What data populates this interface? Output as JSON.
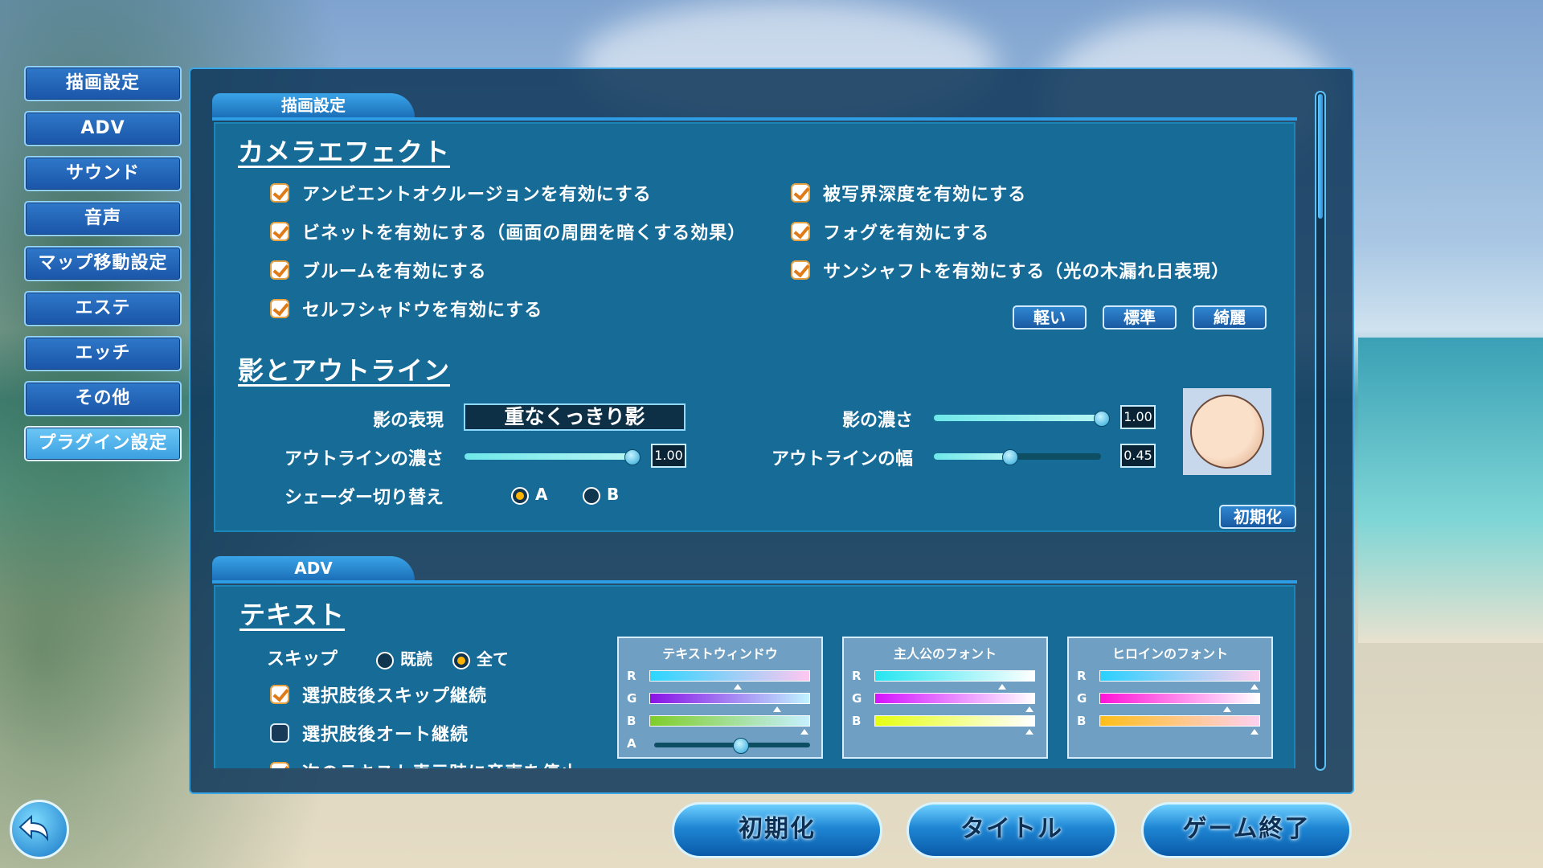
{
  "sidebar": {
    "items": [
      {
        "label": "描画設定"
      },
      {
        "label": "ADV"
      },
      {
        "label": "サウンド"
      },
      {
        "label": "音声"
      },
      {
        "label": "マップ移動設定"
      },
      {
        "label": "エステ"
      },
      {
        "label": "エッチ"
      },
      {
        "label": "その他"
      },
      {
        "label": "プラグイン設定"
      }
    ],
    "active_index": 8
  },
  "render_section": {
    "tab": "描画設定",
    "camera": {
      "heading": "カメラエフェクト",
      "options": [
        {
          "label": "アンビエントオクルージョンを有効にする",
          "checked": true
        },
        {
          "label": "ビネットを有効にする（画面の周囲を暗くする効果）",
          "checked": true
        },
        {
          "label": "ブルームを有効にする",
          "checked": true
        },
        {
          "label": "セルフシャドウを有効にする",
          "checked": true
        },
        {
          "label": "被写界深度を有効にする",
          "checked": true
        },
        {
          "label": "フォグを有効にする",
          "checked": true
        },
        {
          "label": "サンシャフトを有効にする（光の木漏れ日表現）",
          "checked": true
        }
      ],
      "presets": [
        "軽い",
        "標準",
        "綺麗"
      ]
    },
    "shadow": {
      "heading": "影とアウトライン",
      "shadow_style_label": "影の表現",
      "shadow_style_value": "重なくっきり影",
      "outline_density_label": "アウトラインの濃さ",
      "outline_density_value": "1.00",
      "outline_density": 1.0,
      "shader_label": "シェーダー切り替え",
      "shader_options": [
        "A",
        "B"
      ],
      "shader_selected": "A",
      "shadow_density_label": "影の濃さ",
      "shadow_density_value": "1.00",
      "shadow_density": 1.0,
      "outline_width_label": "アウトラインの幅",
      "outline_width_value": "0.45",
      "outline_width": 0.45,
      "reset_label": "初期化"
    }
  },
  "adv_section": {
    "tab": "ADV",
    "text": {
      "heading": "テキスト",
      "skip_label": "スキップ",
      "skip_options": [
        "既読",
        "全て"
      ],
      "skip_selected": "全て",
      "options": [
        {
          "label": "選択肢後スキップ継続",
          "checked": true
        },
        {
          "label": "選択肢後オート継続",
          "checked": false
        },
        {
          "label": "次のテキスト表示時に音声を停止",
          "checked": true
        }
      ]
    },
    "color_panels": [
      {
        "title": "テキストウィンドウ",
        "channels": [
          {
            "name": "R",
            "value": 0.55,
            "colors": [
              "#2bd6ff",
              "#ffc7f0"
            ]
          },
          {
            "name": "G",
            "value": 0.8,
            "colors": [
              "#8a12e6",
              "#bff3ff"
            ]
          },
          {
            "name": "B",
            "value": 0.97,
            "colors": [
              "#7fcd2a",
              "#c6f0ff"
            ]
          },
          {
            "name": "A",
            "value": 0.55,
            "slider": true
          }
        ]
      },
      {
        "title": "主人公のフォント",
        "channels": [
          {
            "name": "R",
            "value": 0.8,
            "colors": [
              "#25e5f0",
              "#ffffff"
            ]
          },
          {
            "name": "G",
            "value": 0.97,
            "colors": [
              "#d412ff",
              "#ffffff"
            ]
          },
          {
            "name": "B",
            "value": 0.97,
            "colors": [
              "#e6ff12",
              "#ffffff"
            ]
          }
        ]
      },
      {
        "title": "ヒロインのフォント",
        "channels": [
          {
            "name": "R",
            "value": 0.97,
            "colors": [
              "#2ad0ff",
              "#ffd0f0"
            ]
          },
          {
            "name": "G",
            "value": 0.8,
            "colors": [
              "#ff12d8",
              "#ffffff"
            ]
          },
          {
            "name": "B",
            "value": 0.97,
            "colors": [
              "#ffbe1a",
              "#ffd0f0"
            ]
          }
        ]
      }
    ]
  },
  "footer": {
    "reset": "初期化",
    "title": "タイトル",
    "quit": "ゲーム終了"
  },
  "colors": {
    "accent": "#3aa8e8",
    "check": "#e07a18",
    "panel": "#176b97"
  }
}
